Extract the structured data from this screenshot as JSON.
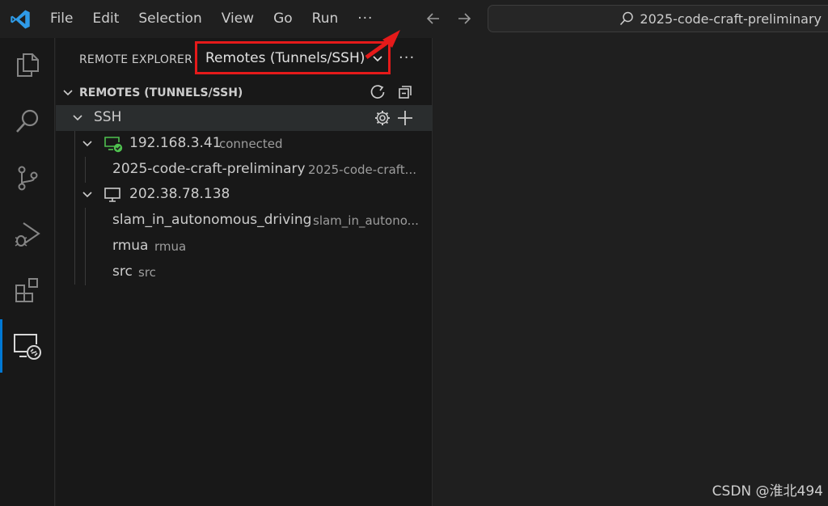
{
  "titlebar": {
    "menu": [
      "File",
      "Edit",
      "Selection",
      "View",
      "Go",
      "Run"
    ],
    "more": "···",
    "command_center": "2025-code-craft-preliminary"
  },
  "activity_bar": {
    "items": [
      "explorer-icon",
      "search-icon",
      "source-control-icon",
      "run-debug-icon",
      "extensions-icon",
      "remote-explorer-icon"
    ],
    "active": "remote-explorer-icon",
    "accent": "#0078d4"
  },
  "sidebar": {
    "title": "REMOTE EXPLORER",
    "dropdown": "Remotes (Tunnels/SSH)",
    "more": "···",
    "highlight_color": "#e51a1a",
    "section": "REMOTES (TUNNELS/SSH)",
    "group": "SSH",
    "hosts": [
      {
        "name": "192.168.3.41",
        "status": "connected",
        "folders": [
          {
            "name": "2025-code-craft-preliminary",
            "path": "2025-code-craft..."
          }
        ]
      },
      {
        "name": "202.38.78.138",
        "status": "",
        "folders": [
          {
            "name": "slam_in_autonomous_driving",
            "path": "slam_in_autono..."
          },
          {
            "name": "rmua",
            "path": "rmua"
          },
          {
            "name": "src",
            "path": "src"
          }
        ]
      }
    ],
    "connected_color": "#4fc14f"
  },
  "watermark": "CSDN @淮北494"
}
